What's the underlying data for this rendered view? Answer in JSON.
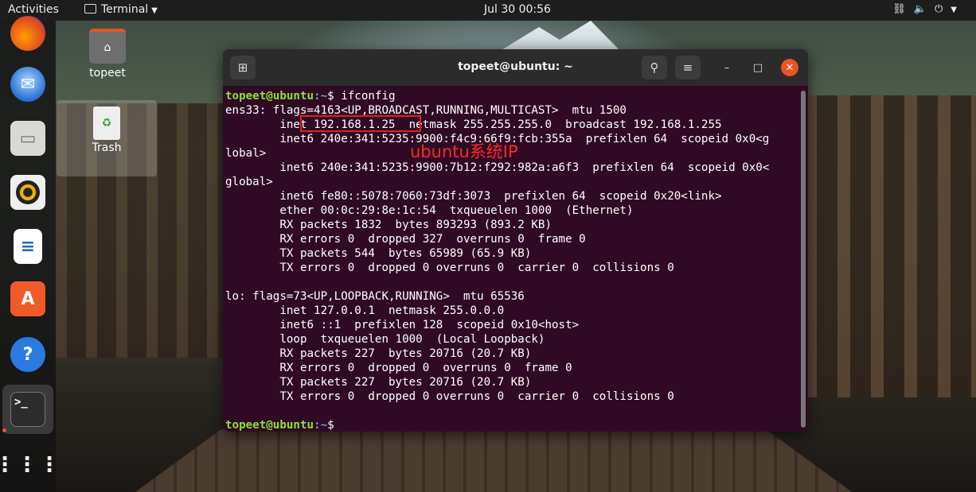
{
  "topbar": {
    "activities": "Activities",
    "app_name": "Terminal",
    "clock": "Jul 30  00:56",
    "tray_icons": [
      "network-icon",
      "volume-icon",
      "power-icon"
    ]
  },
  "dock": {
    "items": [
      "firefox-icon",
      "thunderbird-icon",
      "files-icon",
      "rhythmbox-icon",
      "writer-icon",
      "software-icon",
      "help-icon",
      "terminal-icon",
      "show-apps-icon"
    ]
  },
  "desktop": {
    "icons": [
      {
        "label": "topeet",
        "icon": "home-folder-icon"
      },
      {
        "label": "Trash",
        "icon": "trash-icon"
      }
    ]
  },
  "terminal": {
    "title": "topeet@ubuntu: ~",
    "prompt_user": "topeet@ubuntu",
    "prompt_path": ":~",
    "command": "$ ifconfig",
    "output": [
      "ens33: flags=4163<UP,BROADCAST,RUNNING,MULTICAST>  mtu 1500",
      "        inet 192.168.1.25  netmask 255.255.255.0  broadcast 192.168.1.255",
      "        inet6 240e:341:5235:9900:f4c9:66f9:fcb:355a  prefixlen 64  scopeid 0x0<g",
      "lobal>",
      "        inet6 240e:341:5235:9900:7b12:f292:982a:a6f3  prefixlen 64  scopeid 0x0<",
      "global>",
      "        inet6 fe80::5078:7060:73df:3073  prefixlen 64  scopeid 0x20<link>",
      "        ether 00:0c:29:8e:1c:54  txqueuelen 1000  (Ethernet)",
      "        RX packets 1832  bytes 893293 (893.2 KB)",
      "        RX errors 0  dropped 327  overruns 0  frame 0",
      "        TX packets 544  bytes 65989 (65.9 KB)",
      "        TX errors 0  dropped 0 overruns 0  carrier 0  collisions 0",
      "",
      "lo: flags=73<UP,LOOPBACK,RUNNING>  mtu 65536",
      "        inet 127.0.0.1  netmask 255.0.0.0",
      "        inet6 ::1  prefixlen 128  scopeid 0x10<host>",
      "        loop  txqueuelen 1000  (Local Loopback)",
      "        RX packets 227  bytes 20716 (20.7 KB)",
      "        RX errors 0  dropped 0  overruns 0  frame 0",
      "        TX packets 227  bytes 20716 (20.7 KB)",
      "        TX errors 0  dropped 0 overruns 0  carrier 0  collisions 0",
      ""
    ],
    "final_prompt_symbol": "$"
  },
  "annotation": {
    "label": "ubuntu系统IP",
    "color": "#e0201b"
  }
}
